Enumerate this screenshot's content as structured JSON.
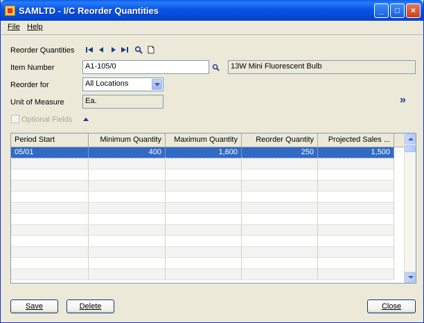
{
  "window": {
    "title": "SAMLTD - I/C Reorder Quantities",
    "minimize_glyph": "_",
    "maximize_glyph": "□",
    "close_glyph": "×"
  },
  "menu": {
    "file": "File",
    "help": "Help"
  },
  "form": {
    "reorder_quantities_label": "Reorder Quantities",
    "item_number_label": "Item Number",
    "item_number_value": "A1-105/0",
    "item_description": "13W Mini Fluorescent Bulb",
    "reorder_for_label": "Reorder for",
    "reorder_for_value": "All Locations",
    "unit_of_measure_label": "Unit of Measure",
    "unit_of_measure_value": "Ea.",
    "optional_fields_label": "Optional Fields",
    "expand_glyph": "»"
  },
  "grid": {
    "columns": [
      "Period Start",
      "Minimum Quantity",
      "Maximum Quantity",
      "Reorder Quantity",
      "Projected Sales ..."
    ],
    "rows": [
      [
        "05/01",
        "400",
        "1,600",
        "250",
        "1,500"
      ]
    ],
    "empty_rows": 11
  },
  "buttons": {
    "save": "Save",
    "delete": "Delete",
    "close": "Close"
  },
  "colors": {
    "selection": "#316AC5",
    "titlebar": "#0A5EF0",
    "nav_icon": "#1E3C8C"
  },
  "icons": {
    "first": "first-record-icon",
    "previous": "previous-record-icon",
    "next": "next-record-icon",
    "last": "last-record-icon",
    "find": "search-icon",
    "new": "new-document-icon"
  }
}
